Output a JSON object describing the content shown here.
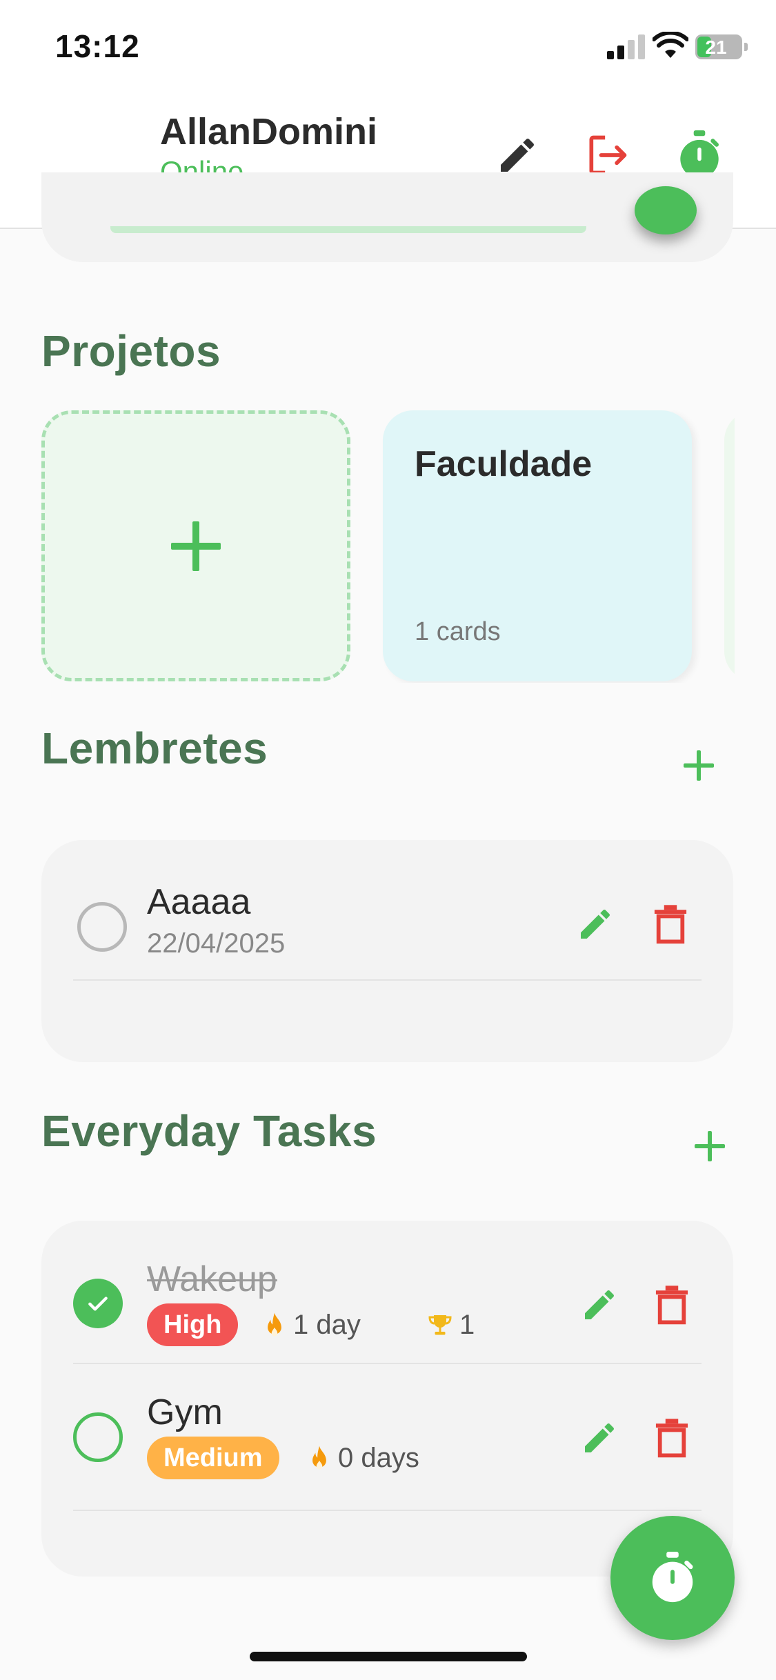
{
  "status_bar": {
    "time": "13:12",
    "battery": "21"
  },
  "header": {
    "username": "AllanDomini",
    "status": "Online"
  },
  "projects": {
    "title": "Projetos",
    "cards": [
      {
        "name": "Faculdade",
        "count": "1 cards"
      }
    ]
  },
  "reminders": {
    "title": "Lembretes",
    "items": [
      {
        "title": "Aaaaa",
        "date": "22/04/2025",
        "done": false
      }
    ]
  },
  "tasks": {
    "title": "Everyday Tasks",
    "items": [
      {
        "title": "Wakeup",
        "priority": "High",
        "streak": "1 day",
        "trophies": "1",
        "done": true
      },
      {
        "title": "Gym",
        "priority": "Medium",
        "streak": "0 days",
        "done": false
      }
    ]
  },
  "colors": {
    "accent": "#4cbe5a",
    "danger": "#e5413a",
    "section_title": "#4a7553",
    "high": "#f25454",
    "medium": "#ffb247"
  }
}
